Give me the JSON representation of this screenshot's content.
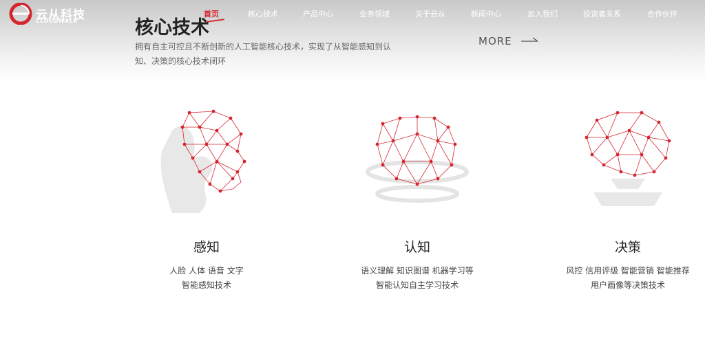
{
  "brand": {
    "name_cn": "云从科技",
    "name_en": "CLOUDWALK",
    "logo_color": "#d4262f"
  },
  "nav": [
    {
      "label": "首页",
      "active": true
    },
    {
      "label": "核心技术"
    },
    {
      "label": "产品中心"
    },
    {
      "label": "业务领域"
    },
    {
      "label": "关于云从"
    },
    {
      "label": "新闻中心"
    },
    {
      "label": "加入我们"
    },
    {
      "label": "投资者关系"
    },
    {
      "label": "合作伙伴"
    }
  ],
  "section": {
    "title": "核心技术",
    "description": "拥有自主可控且不断创新的人工智能核心技术，实现了从智能感知到认知、决策的核心技术闭环",
    "more_label": "MORE"
  },
  "features": [
    {
      "icon": "face-network-icon",
      "title": "感知",
      "lines": [
        "人脸 人体 语音 文字",
        "智能感知技术"
      ]
    },
    {
      "icon": "globe-network-icon",
      "title": "认知",
      "lines": [
        "语义理解 知识图谱 机器学习等",
        "智能认知自主学习技术"
      ]
    },
    {
      "icon": "brain-network-icon",
      "title": "决策",
      "lines": [
        "风控 信用评级 智能营销 智能推荐",
        "用户画像等决策技术"
      ]
    }
  ],
  "colors": {
    "accent": "#d4262f",
    "text_dark": "#222222",
    "text_muted": "#666666"
  }
}
